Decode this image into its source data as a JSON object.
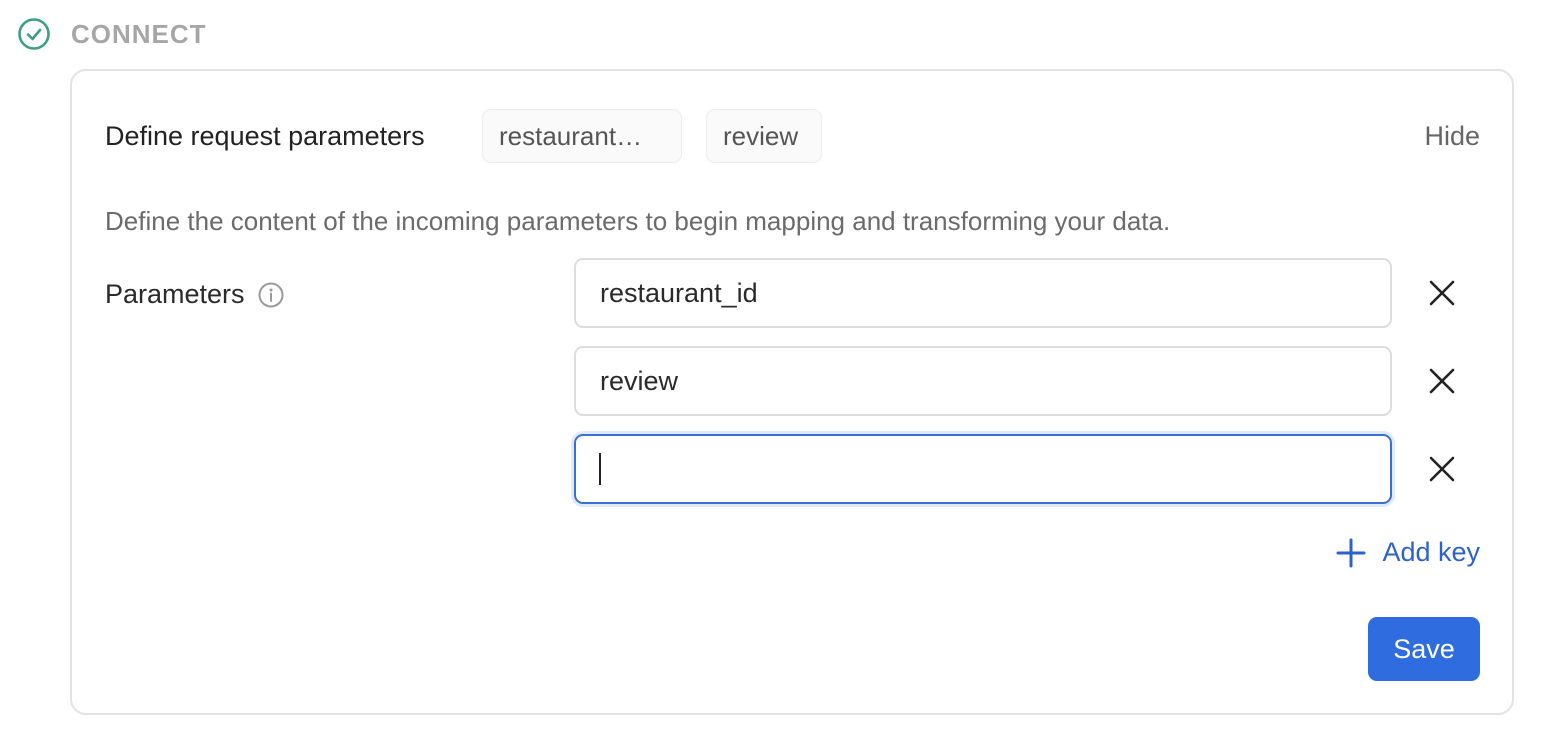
{
  "step": {
    "title": "CONNECT",
    "status_icon": "check-circle-icon",
    "accent_color": "#3aa17e"
  },
  "card": {
    "title": "Define request parameters",
    "chips": [
      "restaurant…",
      "review"
    ],
    "hide_label": "Hide",
    "description": "Define the content of the incoming parameters to begin mapping and transforming your data."
  },
  "parameters": {
    "label": "Parameters",
    "info_icon": "info-icon",
    "rows": [
      {
        "value": "restaurant_id",
        "remove_icon": "close-icon"
      },
      {
        "value": "review",
        "remove_icon": "close-icon"
      },
      {
        "value": "",
        "remove_icon": "close-icon",
        "focused": true
      }
    ],
    "add_key_label": "Add key",
    "add_icon": "plus-icon"
  },
  "actions": {
    "save_label": "Save",
    "primary_color": "#2f6ce0"
  }
}
